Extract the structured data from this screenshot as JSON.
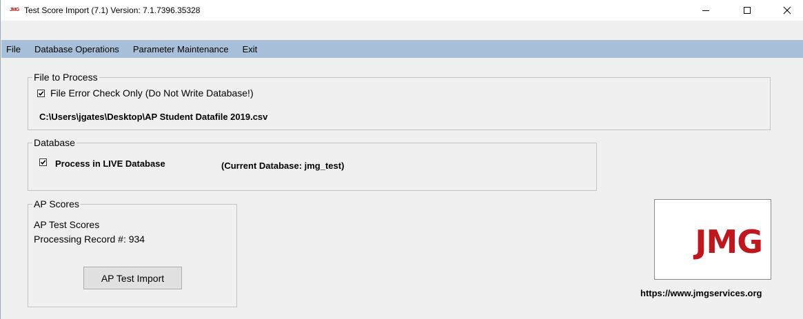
{
  "window": {
    "app_icon_text": "JMG",
    "title": "Test Score Import (7.1) Version: 7.1.7396.35328"
  },
  "menu": {
    "items": [
      "File",
      "Database Operations",
      "Parameter Maintenance",
      "Exit"
    ]
  },
  "file_group": {
    "legend": "File to Process",
    "error_check_label": "File Error Check Only (Do Not Write Database!)",
    "error_check_checked": true,
    "file_path": "C:\\Users\\jgates\\Desktop\\AP Student Datafile 2019.csv"
  },
  "database_group": {
    "legend": "Database",
    "live_label": "Process in LIVE Database",
    "live_checked": true,
    "current_db": "(Current Database: jmg_test)"
  },
  "ap_group": {
    "legend": "AP Scores",
    "heading": "AP Test Scores",
    "processing": "Processing Record #: 934",
    "import_button": "AP Test Import"
  },
  "logo": {
    "text": "JMG",
    "url": "https://www.jmgservices.org",
    "color": "#c0161e"
  }
}
